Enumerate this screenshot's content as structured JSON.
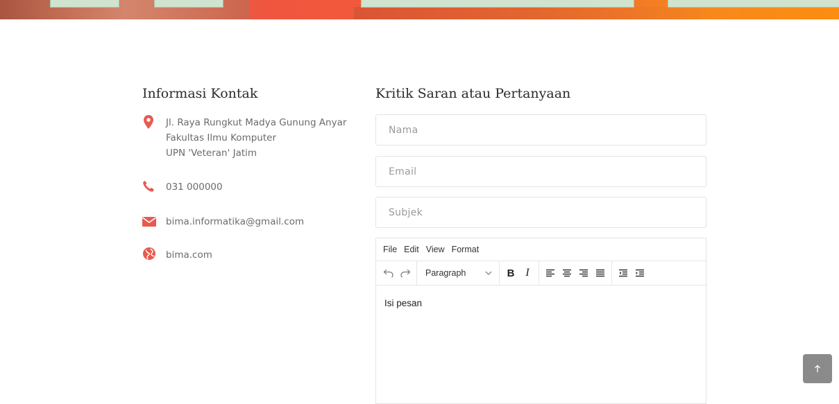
{
  "contact": {
    "title": "Informasi Kontak",
    "address": [
      "Jl. Raya Rungkut Madya Gunung Anyar",
      "Fakultas Ilmu Komputer",
      "UPN 'Veteran' Jatim"
    ],
    "phone": "031 000000",
    "email": "bima.informatika@gmail.com",
    "website": "bima.com"
  },
  "form": {
    "title": "Kritik Saran atau Pertanyaan",
    "name_placeholder": "Nama",
    "email_placeholder": "Email",
    "subject_placeholder": "Subjek",
    "editor": {
      "menu": [
        "File",
        "Edit",
        "View",
        "Format"
      ],
      "block_format": "Paragraph",
      "bold_label": "B",
      "italic_label": "I",
      "content": "Isi pesan"
    }
  },
  "colors": {
    "accent": "#e85a4f",
    "back_to_top_bg": "#8a8a8a"
  },
  "icons": {
    "address": "map-marker-icon",
    "phone": "phone-icon",
    "email": "envelope-icon",
    "website": "globe-icon",
    "back_to_top": "arrow-up-icon"
  }
}
